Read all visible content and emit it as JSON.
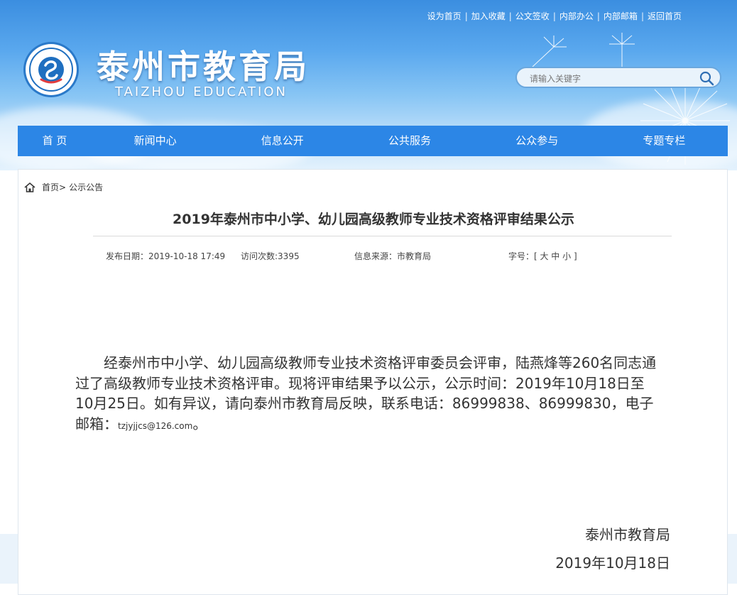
{
  "top_links": [
    "设为首页",
    "加入收藏",
    "公文签收",
    "内部办公",
    "内部邮箱",
    "返回首页"
  ],
  "site": {
    "title": "泰州市教育局",
    "subtitle": "TAIZHOU EDUCATION"
  },
  "search": {
    "placeholder": "请输入关键字"
  },
  "nav": [
    "首 页",
    "新闻中心",
    "信息公开",
    "公共服务",
    "公众参与",
    "专题专栏"
  ],
  "breadcrumb": {
    "home": "首页>",
    "current": "公示公告"
  },
  "article": {
    "title": "2019年泰州市中小学、幼儿园高级教师专业技术资格评审结果公示",
    "meta_date": "发布日期：2019-10-18 17:49",
    "meta_visits": "访问次数:3395",
    "meta_source": "信息来源：市教育局",
    "meta_font": "字号：[ 大 中 小 ]",
    "body_main": "经泰州市中小学、幼儿园高级教师专业技术资格评审委员会评审，陆燕烽等260名同志通过了高级教师专业技术资格评审。现将评审结果予以公示，公示时间：2019年10月18日至10月25日。如有异议，请向泰州市教育局反映，联系电话：86999838、86999830，电子邮箱：",
    "email": "tzjyjjcs@126.com",
    "body_end": "。",
    "signature": "泰州市教育局",
    "sign_date": "2019年10月18日"
  },
  "colors": {
    "nav": "#2c86e6",
    "header_top": "#3b8ee0"
  }
}
